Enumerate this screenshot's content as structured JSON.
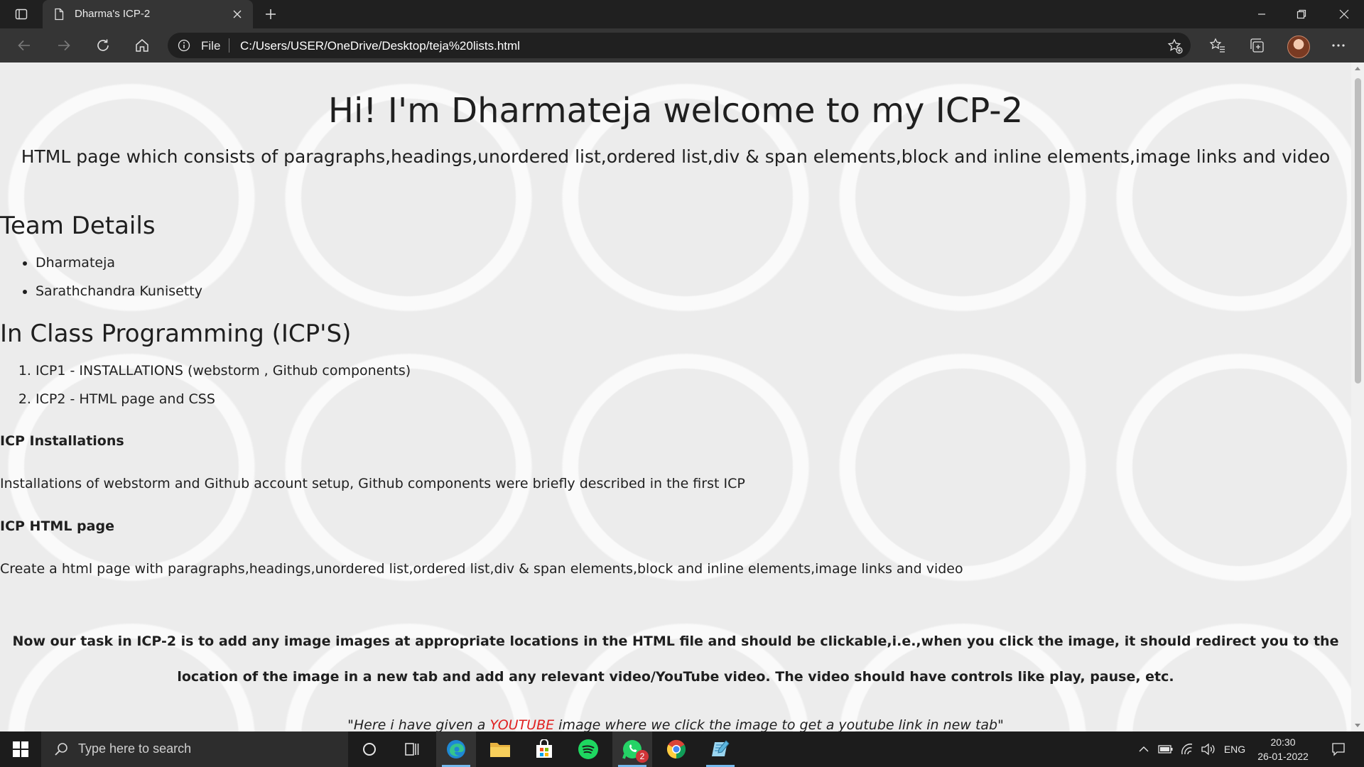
{
  "browser": {
    "tab_title": "Dharma's ICP-2",
    "address_scheme_label": "File",
    "address_url": "C:/Users/USER/OneDrive/Desktop/teja%20lists.html"
  },
  "page": {
    "title": "Hi! I'm Dharmateja welcome to my ICP-2",
    "subtitle": "HTML page which consists of paragraphs,headings,unordered list,ordered list,div & span elements,block and inline elements,image links and video",
    "team_heading": "Team Details",
    "team_members": [
      "Dharmateja",
      "Sarathchandra Kunisetty"
    ],
    "icp_heading": "In Class Programming (ICP'S)",
    "icp_items": [
      "ICP1 - INSTALLATIONS (webstorm , Github components)",
      "ICP2 - HTML page and CSS"
    ],
    "install_heading": "ICP Installations",
    "install_text": "Installations of webstorm and Github account setup, Github components were briefly described in the first ICP",
    "html_heading": "ICP HTML page",
    "html_text": "Create a html page with paragraphs,headings,unordered list,ordered list,div & span elements,block and inline elements,image links and video",
    "task_text": "Now our task in ICP-2 is to add any image images at appropriate locations in the HTML file and should be clickable,i.e.,when you click the image, it should redirect you to the location of the image in a new tab and add any relevant video/YouTube video. The video should have controls like play, pause, etc.",
    "quote_before": "\"Here i have given a ",
    "quote_link": "YOUTUBE",
    "quote_after": " image where we click the image to get a youtube link in new tab\""
  },
  "taskbar": {
    "search_placeholder": "Type here to search",
    "whatsapp_badge": "2",
    "language": "ENG",
    "time": "20:30",
    "date": "26-01-2022"
  },
  "colors": {
    "browser_frame": "#202020",
    "toolbar": "#353535",
    "page_background": "#ececec",
    "link_red": "#e02020",
    "taskbar": "#1c1c1c"
  }
}
